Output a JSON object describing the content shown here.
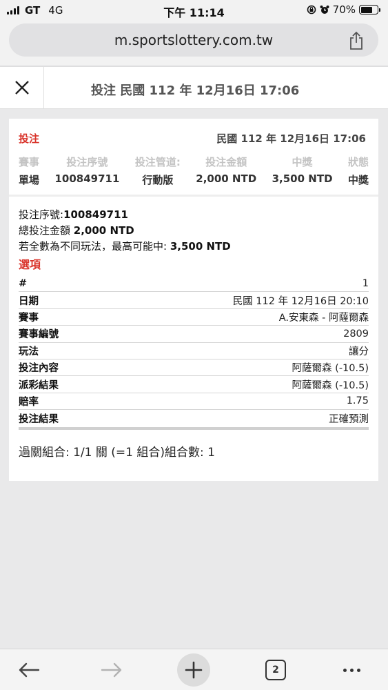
{
  "status_bar": {
    "carrier": "GT",
    "network": "4G",
    "time": "下午 11:14",
    "battery": "70%",
    "battery_level": 0.7
  },
  "browser": {
    "url": "m.sportslottery.com.tw"
  },
  "header": {
    "title": "投注 民國 112 年 12月16日 17:06"
  },
  "bet": {
    "label": "投注",
    "date": "民國 112 年 12月16日 17:06",
    "summary": [
      {
        "head": "賽事",
        "value": "單場"
      },
      {
        "head": "投注序號",
        "value": "100849711"
      },
      {
        "head": "投注管道:",
        "value": "行動版"
      },
      {
        "head": "投注金額",
        "value": "2,000 NTD"
      },
      {
        "head": "中獎",
        "value": "3,500 NTD"
      },
      {
        "head": "狀態",
        "value": "中獎"
      }
    ]
  },
  "details": {
    "serial_label": "投注序號:",
    "serial_value": "100849711",
    "total_label": "總投注金額 ",
    "total_value": "2,000 NTD",
    "max_label": "若全數為不同玩法，最高可能中: ",
    "max_value": "3,500 NTD",
    "options_title": "選項"
  },
  "options": [
    {
      "k": "#",
      "v": "1"
    },
    {
      "k": "日期",
      "v": "民國 112 年 12月16日 20:10"
    },
    {
      "k": "賽事",
      "v": "A.安東森 - 阿薩爾森"
    },
    {
      "k": "賽事編號",
      "v": "2809"
    },
    {
      "k": "玩法",
      "v": "讓分"
    },
    {
      "k": "投注內容",
      "v": "阿薩爾森 (-10.5)"
    },
    {
      "k": "派彩結果",
      "v": "阿薩爾森 (-10.5)"
    },
    {
      "k": "賠率",
      "v": "1.75"
    },
    {
      "k": "投注結果",
      "v": "正確預測"
    }
  ],
  "combo": "過關組合: 1/1 關 (=1 組合)組合數: 1",
  "toolbar": {
    "tab_count": "2"
  },
  "colors": {
    "accent_red": "#d9342b",
    "muted_head": "#c4c4c4"
  }
}
